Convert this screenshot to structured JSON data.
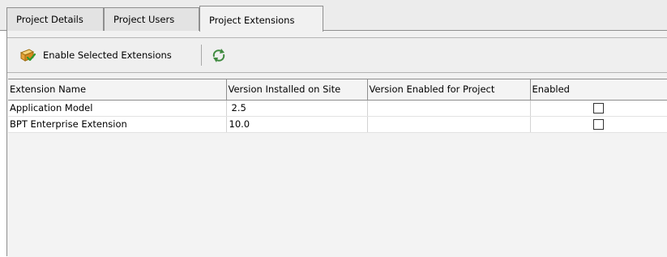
{
  "tabs": [
    {
      "label": "Project Details",
      "active": false
    },
    {
      "label": "Project Users",
      "active": false
    },
    {
      "label": "Project Extensions",
      "active": true
    }
  ],
  "toolbar": {
    "enable_label": "Enable Selected Extensions",
    "enable_icon": "extension-enable-icon",
    "refresh_icon": "refresh-icon"
  },
  "table": {
    "headers": [
      "Extension Name",
      "Version Installed on Site",
      "Version Enabled for Project",
      "Enabled"
    ],
    "rows": [
      {
        "name": "Application Model",
        "installed": "2.5",
        "enabled_version": "",
        "enabled": false
      },
      {
        "name": "BPT Enterprise Extension",
        "installed": "10.0",
        "enabled_version": "",
        "enabled": false
      }
    ]
  }
}
